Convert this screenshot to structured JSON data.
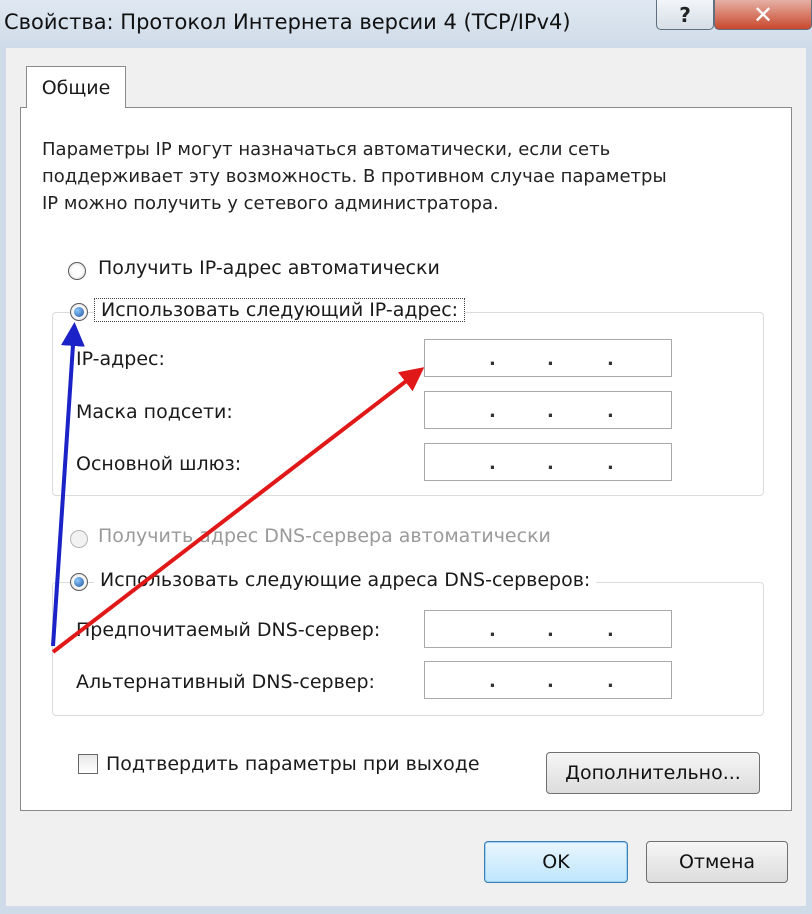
{
  "window": {
    "title": "Свойства: Протокол Интернета версии 4 (TCP/IPv4)",
    "help_glyph": "?",
    "close_glyph": "✕"
  },
  "tabs": [
    {
      "label": "Общие",
      "selected": true
    }
  ],
  "description": [
    "Параметры IP могут назначаться автоматически, если сеть",
    "поддерживает эту возможность. В противном случае параметры",
    "IP можно получить у сетевого администратора."
  ],
  "ip_section": {
    "auto_label": "Получить IP-адрес автоматически",
    "manual_label": "Использовать следующий IP-адрес:",
    "selected": "manual",
    "fields": [
      {
        "label": "IP-адрес:",
        "value": ". . ."
      },
      {
        "label": "Маска подсети:",
        "value": ". . ."
      },
      {
        "label": "Основной шлюз:",
        "value": ". . ."
      }
    ]
  },
  "dns_section": {
    "auto_label": "Получить адрес DNS-сервера автоматически",
    "manual_label": "Использовать следующие адреса DNS-серверов:",
    "auto_disabled": true,
    "selected": "manual",
    "fields": [
      {
        "label": "Предпочитаемый DNS-сервер:",
        "value": ". . ."
      },
      {
        "label": "Альтернативный DNS-сервер:",
        "value": ". . ."
      }
    ]
  },
  "validate_checkbox": {
    "label": "Подтвердить параметры при выходе",
    "checked": false
  },
  "buttons": {
    "advanced": "Дополнительно...",
    "ok": "OK",
    "cancel": "Отмена"
  },
  "annotation_colors": {
    "blue_arrow": "#1a22c8",
    "red_arrow": "#e01818"
  }
}
